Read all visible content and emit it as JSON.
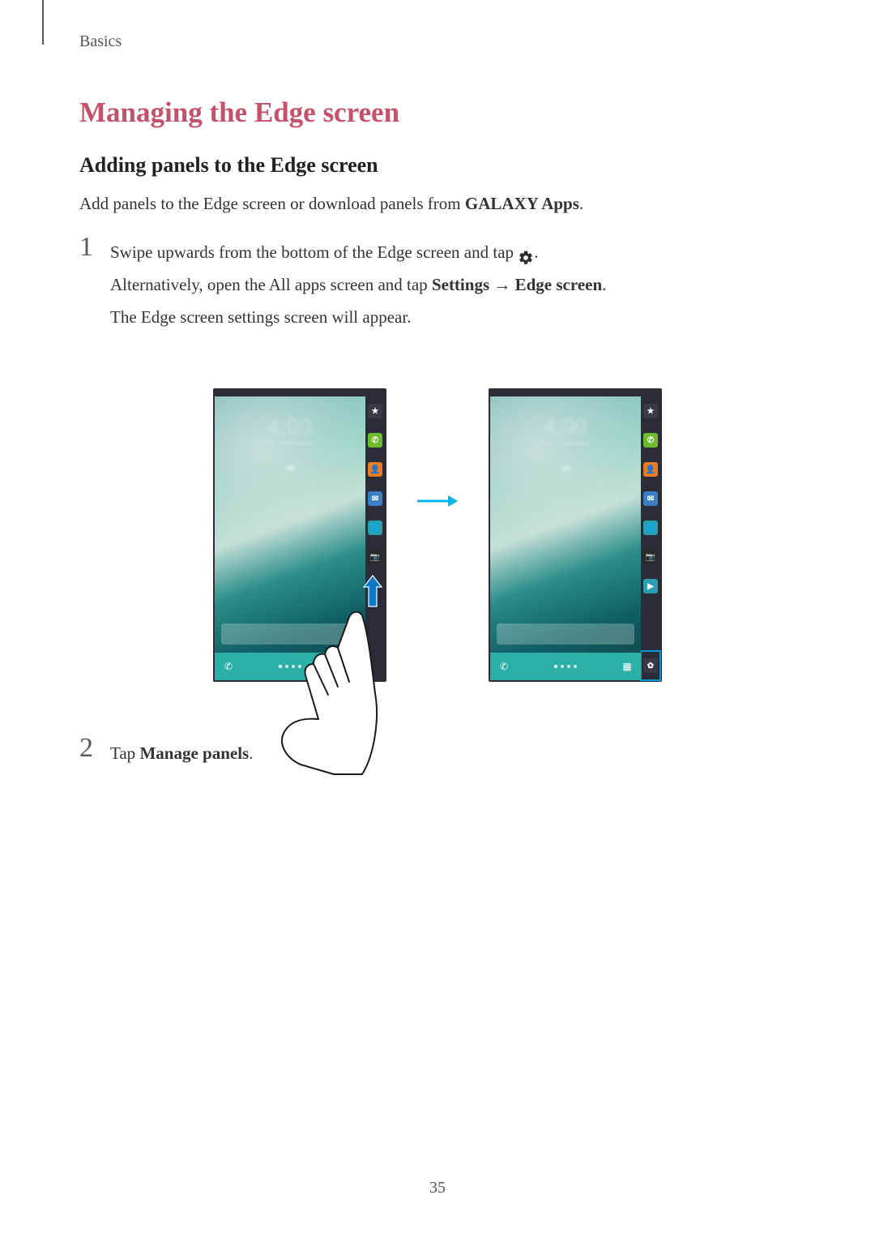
{
  "section": "Basics",
  "title": "Managing the Edge screen",
  "subtitle": "Adding panels to the Edge screen",
  "intro_prefix": "Add panels to the Edge screen or download panels from ",
  "intro_bold": "GALAXY Apps",
  "intro_suffix": ".",
  "steps": {
    "1": {
      "number": "1",
      "line1_prefix": "Swipe upwards from the bottom of the Edge screen and tap ",
      "line1_suffix": ".",
      "line2_prefix": "Alternatively, open the All apps screen and tap ",
      "line2_bold1": "Settings",
      "line2_arrow": " → ",
      "line2_bold2": "Edge screen",
      "line2_suffix": ".",
      "line3": "The Edge screen settings screen will appear."
    },
    "2": {
      "number": "2",
      "text_prefix": "Tap ",
      "text_bold": "Manage panels",
      "text_suffix": "."
    }
  },
  "page_number": "35",
  "icons": {
    "gear": "gear-icon",
    "transition_arrow": "arrow-right-icon",
    "swipe_arrow": "swipe-up-arrow-icon",
    "edge_star": "star-icon",
    "edge_phone": "phone-icon",
    "edge_contacts": "contacts-icon",
    "edge_messages": "messages-icon",
    "edge_browser": "browser-icon",
    "edge_camera": "camera-icon",
    "edge_playstore": "play-store-icon",
    "edge_settings": "settings-icon",
    "nav_phone": "nav-phone-icon",
    "nav_apps": "nav-apps-icon"
  },
  "figure": {
    "clock_time": "4:00",
    "clock_date": "Tue, 30 September"
  }
}
